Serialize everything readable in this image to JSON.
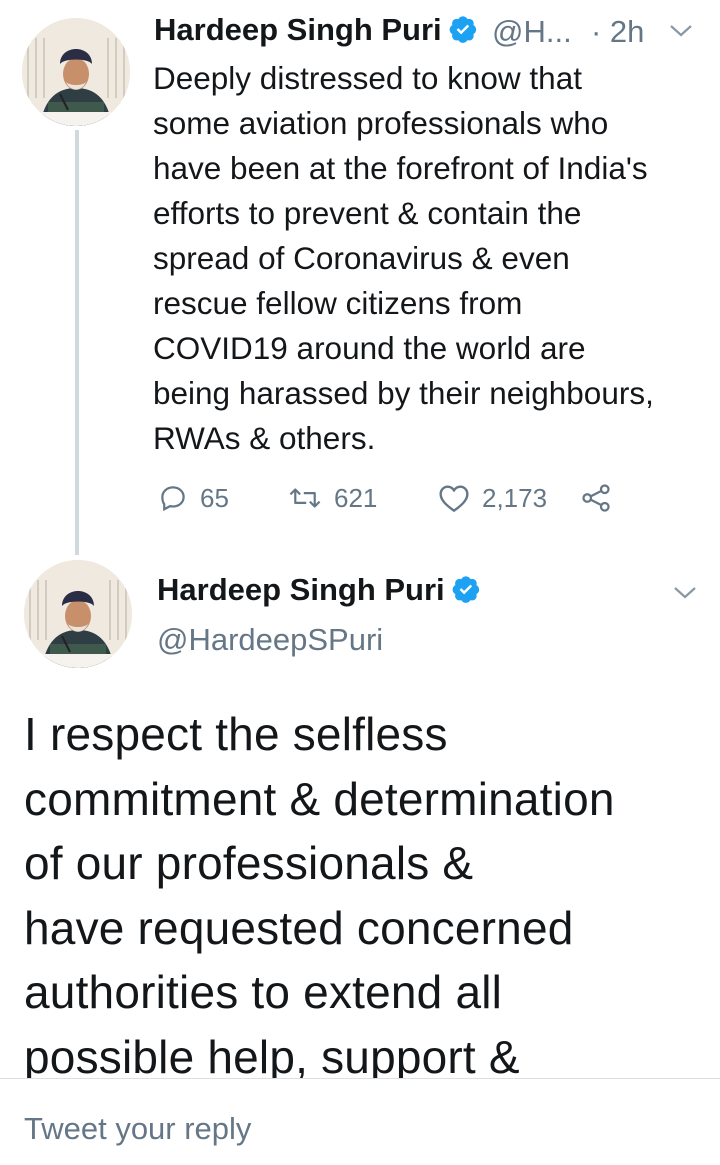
{
  "tweet1": {
    "author_name": "Hardeep Singh Puri",
    "handle_truncated": "@H...",
    "time": "· 2h",
    "body": "Deeply distressed to know that\nsome aviation professionals who\nhave been at the forefront of India's\nefforts to prevent & contain the\nspread of Coronavirus & even\nrescue fellow citizens from\nCOVID19 around the world are\nbeing harassed by their neighbours,\nRWAs & others.",
    "replies": "65",
    "retweets": "621",
    "likes": "2,173"
  },
  "tweet2": {
    "author_name": "Hardeep Singh Puri",
    "handle": "@HardeepSPuri",
    "body": "I respect the selfless\ncommitment & determination\nof our professionals &\nhave requested concerned\nauthorities to extend all\npossible help, support &"
  },
  "reply": {
    "placeholder": "Tweet your reply"
  },
  "colors": {
    "verified": "#1da1f2",
    "muted": "#657786",
    "text": "#14171a"
  },
  "icons": [
    "verified-badge-icon",
    "chevron-down-icon",
    "reply-icon",
    "retweet-icon",
    "like-icon",
    "share-icon"
  ]
}
